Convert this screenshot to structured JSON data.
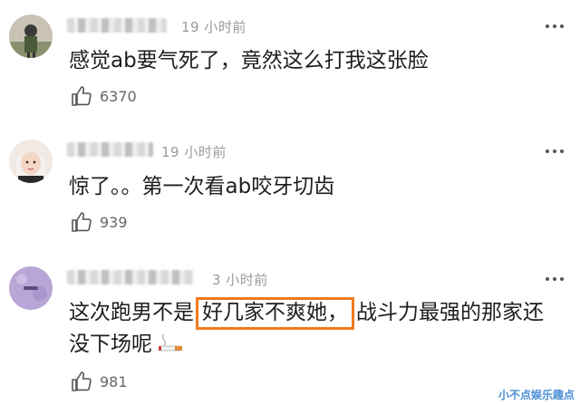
{
  "comments": [
    {
      "time": "19 小时前",
      "text": "感觉ab要气死了，竟然这么打我这张脸",
      "likes": "6370"
    },
    {
      "time": "19 小时前",
      "text": "惊了。。第一次看ab咬牙切齿",
      "likes": "939"
    },
    {
      "time": "3 小时前",
      "text_before": "这次跑男不是",
      "text_highlight": "好几家不爽她，",
      "text_after": "战斗力最强的那家还",
      "text_line2": "没下场呢",
      "likes": "981"
    }
  ],
  "colors": {
    "highlight_border": "#f07b1f",
    "watermark": "#4a8fd6"
  },
  "icons": {
    "like": "thumbs-up-icon",
    "more": "more-dots-icon",
    "emoji": "cigarette-emoji"
  },
  "watermark": "小不点娱乐趣点"
}
